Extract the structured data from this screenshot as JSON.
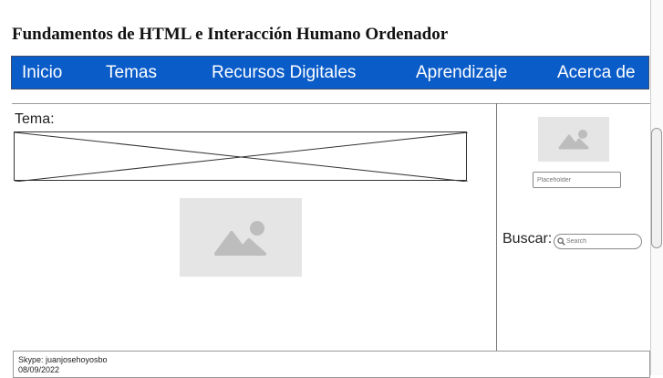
{
  "header": {
    "title": "Fundamentos de HTML e Interacción Humano Ordenador"
  },
  "nav": {
    "items": [
      {
        "label": "Inicio"
      },
      {
        "label": "Temas"
      },
      {
        "label": "Recursos Digitales"
      },
      {
        "label": "Aprendizaje"
      },
      {
        "label": "Acerca de"
      }
    ]
  },
  "main": {
    "topic_label": "Tema:"
  },
  "sidebar": {
    "placeholder_input": {
      "placeholder": "Placeholder"
    },
    "search": {
      "label": "Buscar:",
      "placeholder": "Search"
    }
  },
  "footer": {
    "skype": "Skype: juanjosehoyosbo",
    "date": "08/09/2022"
  },
  "colors": {
    "nav_bg": "#0a5cc9",
    "nav_text": "#ffffff",
    "placeholder_bg": "#e5e5e5"
  }
}
